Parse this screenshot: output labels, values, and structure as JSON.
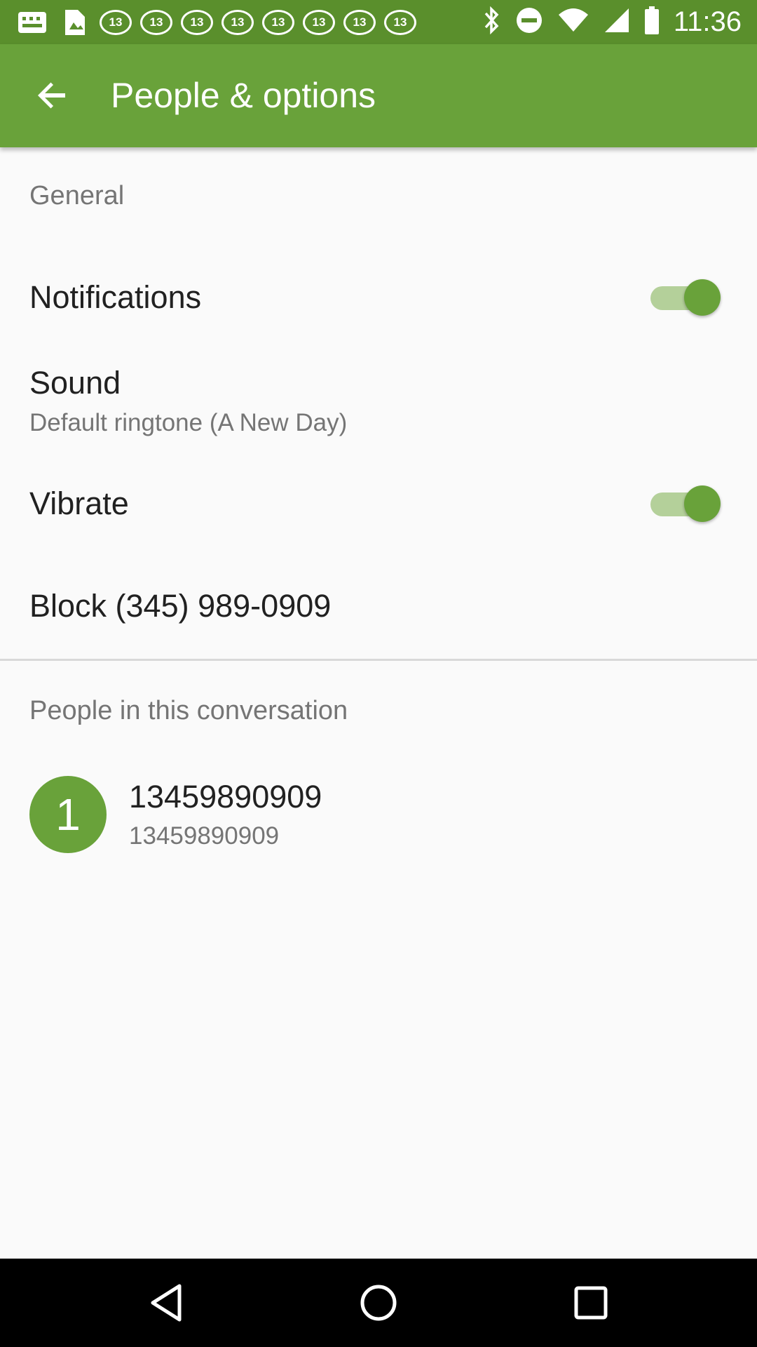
{
  "status_bar": {
    "time": "11:36",
    "notification_icons": [
      "message-icon",
      "image-icon",
      "abc13-icon",
      "abc13-icon",
      "abc13-icon",
      "abc13-icon",
      "abc13-icon",
      "abc13-icon",
      "abc13-icon",
      "abc13-icon"
    ],
    "badge_text": "13",
    "system_icons": [
      "bluetooth-icon",
      "do-not-disturb-icon",
      "wifi-icon",
      "signal-icon",
      "battery-icon"
    ]
  },
  "app_bar": {
    "title": "People & options"
  },
  "general_section": {
    "header": "General",
    "notifications": {
      "label": "Notifications",
      "enabled": true
    },
    "sound": {
      "label": "Sound",
      "summary": "Default ringtone (A New Day)"
    },
    "vibrate": {
      "label": "Vibrate",
      "enabled": true
    },
    "block": {
      "label": "Block (345) 989-0909"
    }
  },
  "people_section": {
    "header": "People in this conversation",
    "people": [
      {
        "avatar_text": "1",
        "name": "13459890909",
        "number": "13459890909"
      }
    ]
  },
  "colors": {
    "status_bar": "#5a8f2c",
    "app_bar": "#69a23a",
    "accent": "#69a23a",
    "switch_track": "#b4d09a"
  }
}
